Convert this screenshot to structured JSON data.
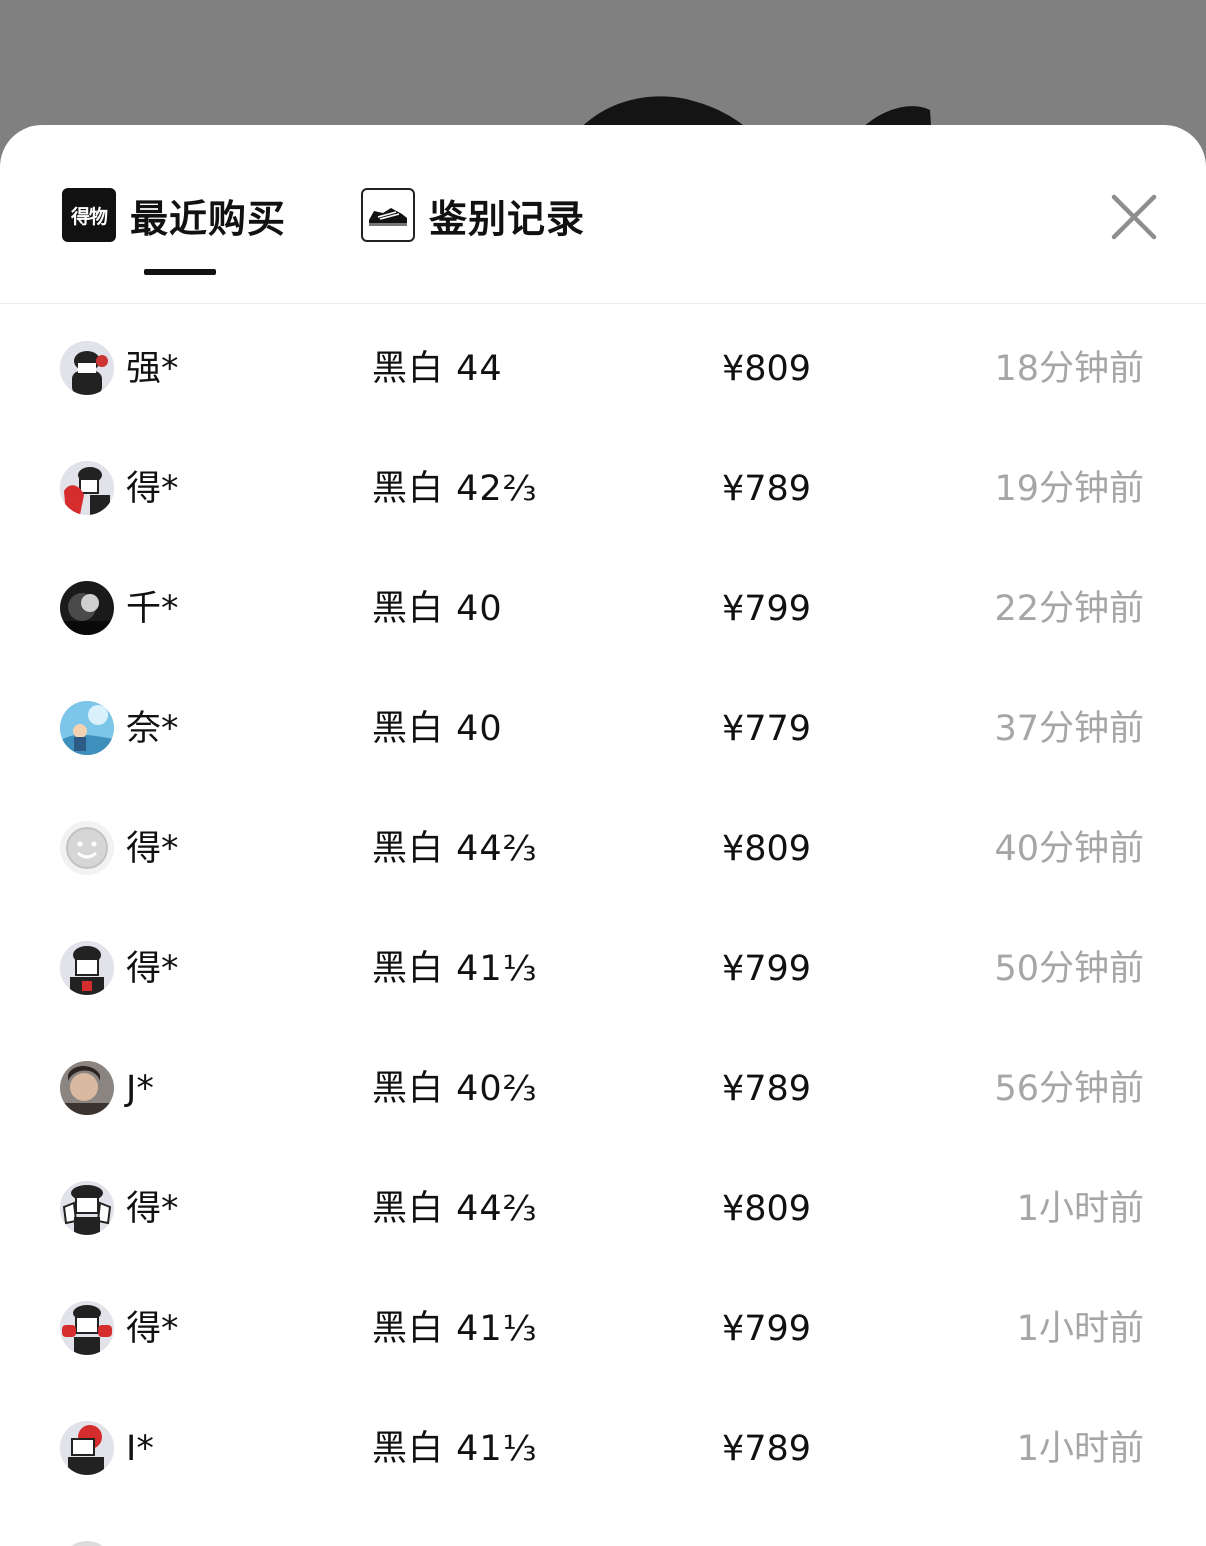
{
  "tabs": {
    "recent_purchases": {
      "icon_text": "得物",
      "label": "最近购买"
    },
    "authentication": {
      "label": "鉴别记录"
    }
  },
  "purchases": [
    {
      "user": "强*",
      "size": "黑白 44",
      "price": "¥809",
      "time": "18分钟前"
    },
    {
      "user": "得*",
      "size": "黑白 42⅔",
      "price": "¥789",
      "time": "19分钟前"
    },
    {
      "user": "千*",
      "size": "黑白 40",
      "price": "¥799",
      "time": "22分钟前"
    },
    {
      "user": "奈*",
      "size": "黑白 40",
      "price": "¥779",
      "time": "37分钟前"
    },
    {
      "user": "得*",
      "size": "黑白 44⅔",
      "price": "¥809",
      "time": "40分钟前"
    },
    {
      "user": "得*",
      "size": "黑白 41⅓",
      "price": "¥799",
      "time": "50分钟前"
    },
    {
      "user": "J*",
      "size": "黑白 40⅔",
      "price": "¥789",
      "time": "56分钟前"
    },
    {
      "user": "得*",
      "size": "黑白 44⅔",
      "price": "¥809",
      "time": "1小时前"
    },
    {
      "user": "得*",
      "size": "黑白 41⅓",
      "price": "¥799",
      "time": "1小时前"
    },
    {
      "user": "I*",
      "size": "黑白 41⅓",
      "price": "¥789",
      "time": "1小时前"
    }
  ],
  "colors": {
    "backdrop": "#808080",
    "sheet": "#ffffff",
    "primary_text": "#111111",
    "secondary_text": "#a6a6a6"
  }
}
